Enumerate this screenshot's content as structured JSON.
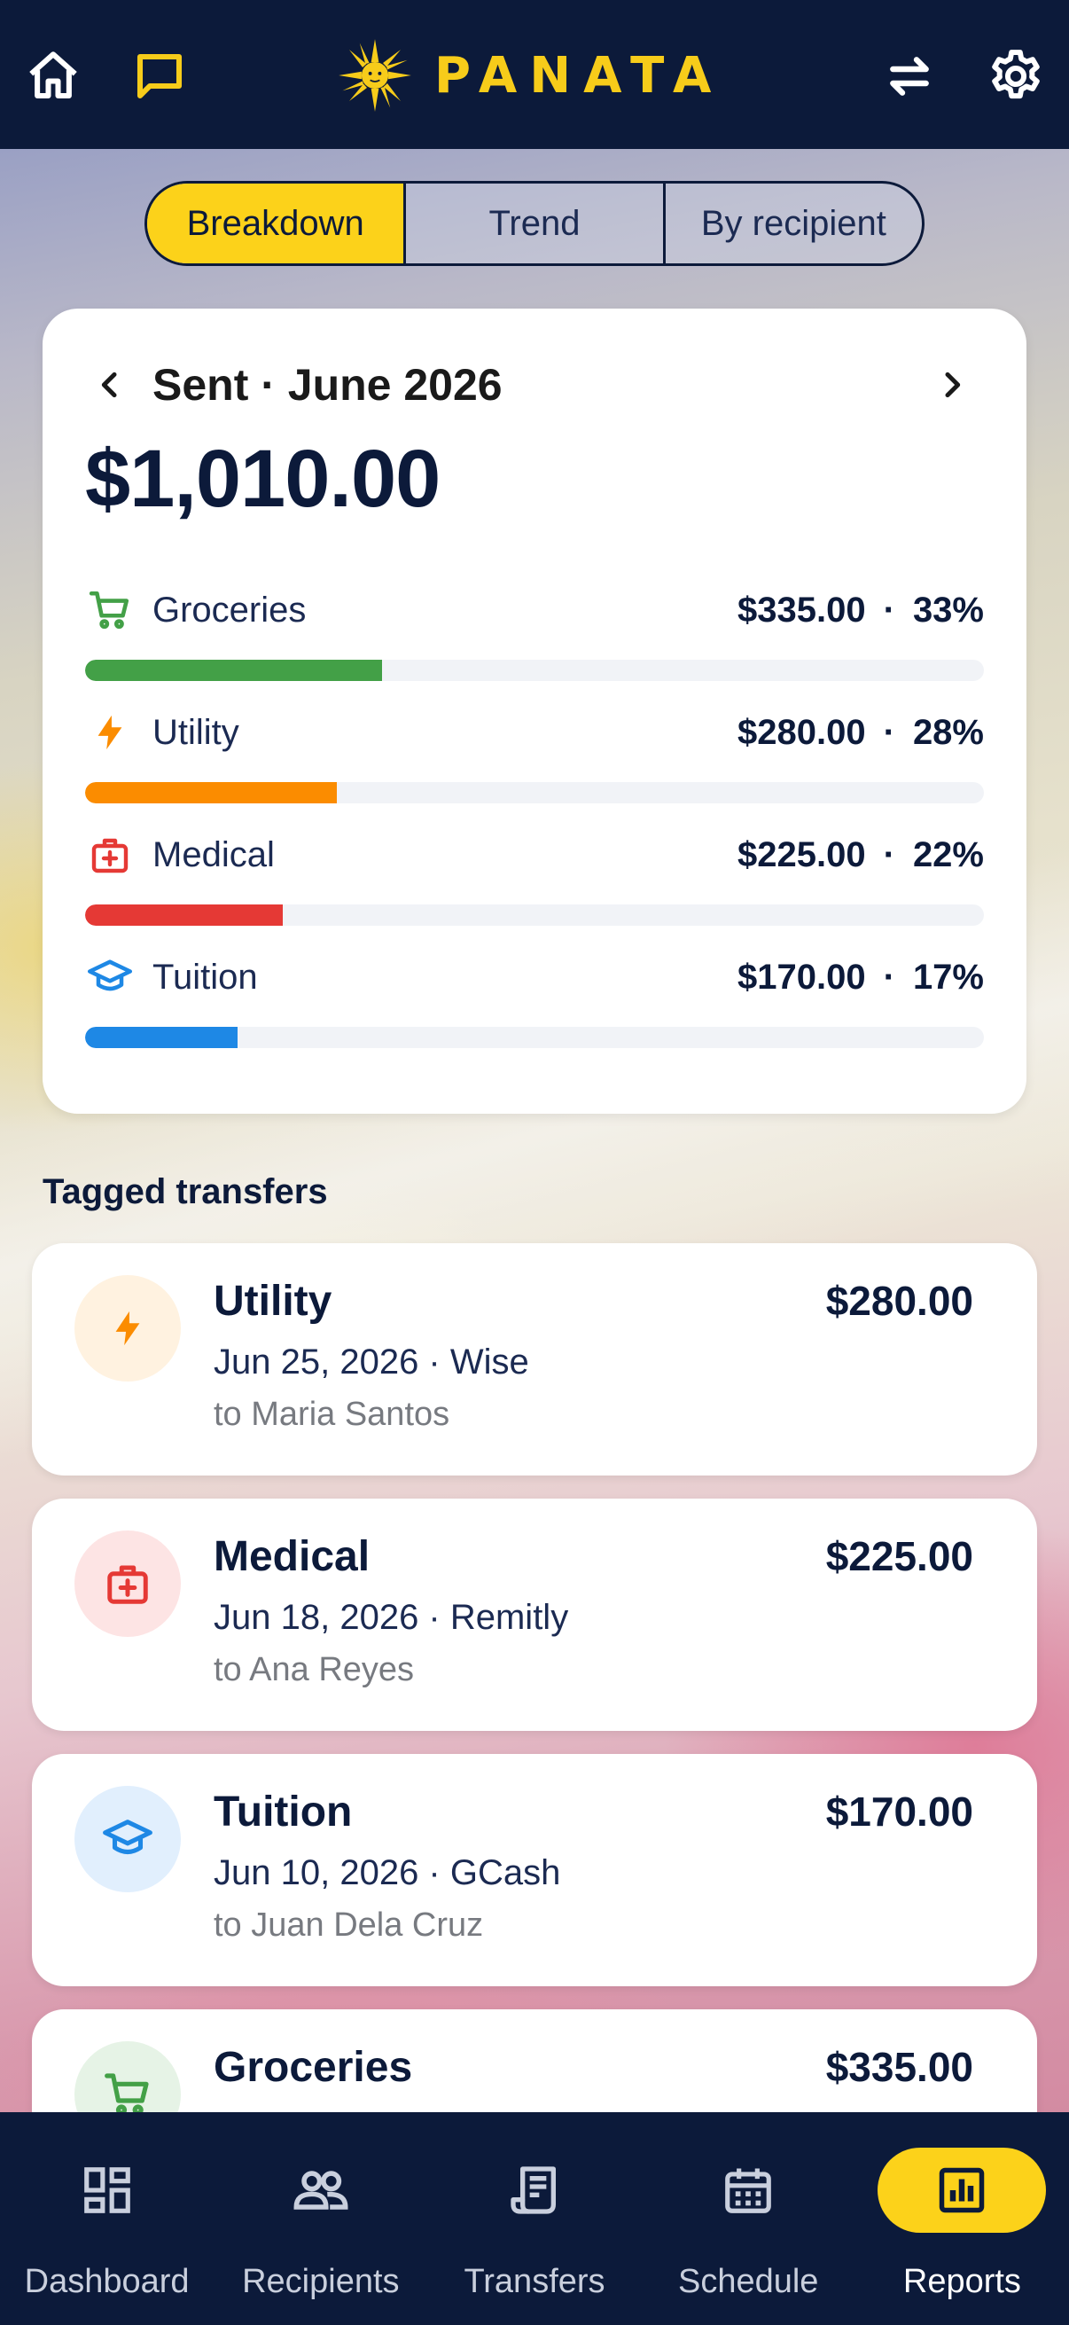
{
  "app": {
    "name": "PANATA"
  },
  "header": {
    "icons": [
      "home-icon",
      "chat-icon",
      "sun-logo",
      "swap-icon",
      "gear-icon"
    ]
  },
  "tabs": [
    {
      "label": "Breakdown",
      "active": true
    },
    {
      "label": "Trend",
      "active": false
    },
    {
      "label": "By recipient",
      "active": false
    }
  ],
  "breakdown": {
    "title": "Sent · June 2026",
    "total": "$1,010.00",
    "categories": [
      {
        "label": "Groceries",
        "amount": "$335.00",
        "percent": "33%",
        "share": 0.33,
        "color": "#43a047",
        "icon": "cart-icon"
      },
      {
        "label": "Utility",
        "amount": "$280.00",
        "percent": "28%",
        "share": 0.28,
        "color": "#fb8c00",
        "icon": "bolt-icon"
      },
      {
        "label": "Medical",
        "amount": "$225.00",
        "percent": "22%",
        "share": 0.22,
        "color": "#e53935",
        "icon": "medkit-icon"
      },
      {
        "label": "Tuition",
        "amount": "$170.00",
        "percent": "17%",
        "share": 0.17,
        "color": "#1e88e5",
        "icon": "cap-icon"
      }
    ]
  },
  "tagged": {
    "title": "Tagged transfers",
    "items": [
      {
        "title": "Utility",
        "amount": "$280.00",
        "sub": "Jun 25, 2026 · Wise",
        "to": "to Maria Santos",
        "icon": "bolt-icon",
        "tint": "#fff2e0"
      },
      {
        "title": "Medical",
        "amount": "$225.00",
        "sub": "Jun 18, 2026 · Remitly",
        "to": "to Ana Reyes",
        "icon": "medkit-icon",
        "tint": "#fde4e4"
      },
      {
        "title": "Tuition",
        "amount": "$170.00",
        "sub": "Jun 10, 2026 · GCash",
        "to": "to Juan Dela Cruz",
        "icon": "cap-icon",
        "tint": "#e1effd"
      },
      {
        "title": "Groceries",
        "amount": "$335.00",
        "sub": "",
        "to": "",
        "icon": "cart-icon",
        "tint": "#e6f3e6"
      }
    ]
  },
  "nav": [
    {
      "label": "Dashboard",
      "icon": "dashboard-icon",
      "active": false
    },
    {
      "label": "Recipients",
      "icon": "people-icon",
      "active": false
    },
    {
      "label": "Transfers",
      "icon": "receipt-icon",
      "active": false
    },
    {
      "label": "Schedule",
      "icon": "calendar-icon",
      "active": false
    },
    {
      "label": "Reports",
      "icon": "chart-icon",
      "active": true
    }
  ]
}
